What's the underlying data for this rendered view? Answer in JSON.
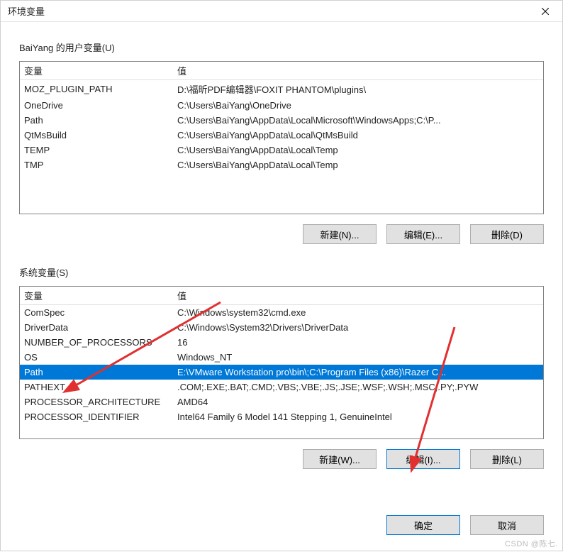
{
  "window": {
    "title": "环境变量",
    "close_icon": "close-icon"
  },
  "user_group": {
    "label": "BaiYang 的用户变量(U)",
    "col1": "变量",
    "col2": "值",
    "rows": [
      {
        "name": "MOZ_PLUGIN_PATH",
        "value": "D:\\福昕PDF编辑器\\FOXIT PHANTOM\\plugins\\"
      },
      {
        "name": "OneDrive",
        "value": "C:\\Users\\BaiYang\\OneDrive"
      },
      {
        "name": "Path",
        "value": "C:\\Users\\BaiYang\\AppData\\Local\\Microsoft\\WindowsApps;C:\\P..."
      },
      {
        "name": "QtMsBuild",
        "value": "C:\\Users\\BaiYang\\AppData\\Local\\QtMsBuild"
      },
      {
        "name": "TEMP",
        "value": "C:\\Users\\BaiYang\\AppData\\Local\\Temp"
      },
      {
        "name": "TMP",
        "value": "C:\\Users\\BaiYang\\AppData\\Local\\Temp"
      }
    ],
    "buttons": {
      "new": "新建(N)...",
      "edit": "编辑(E)...",
      "delete": "删除(D)"
    }
  },
  "system_group": {
    "label": "系统变量(S)",
    "col1": "变量",
    "col2": "值",
    "rows": [
      {
        "name": "ComSpec",
        "value": "C:\\Windows\\system32\\cmd.exe"
      },
      {
        "name": "DriverData",
        "value": "C:\\Windows\\System32\\Drivers\\DriverData"
      },
      {
        "name": "NUMBER_OF_PROCESSORS",
        "value": "16"
      },
      {
        "name": "OS",
        "value": "Windows_NT"
      },
      {
        "name": "Path",
        "value": "E:\\VMware Workstation pro\\bin\\;C:\\Program Files (x86)\\Razer C...",
        "selected": true
      },
      {
        "name": "PATHEXT",
        "value": ".COM;.EXE;.BAT;.CMD;.VBS;.VBE;.JS;.JSE;.WSF;.WSH;.MSC;.PY;.PYW"
      },
      {
        "name": "PROCESSOR_ARCHITECTURE",
        "value": "AMD64"
      },
      {
        "name": "PROCESSOR_IDENTIFIER",
        "value": "Intel64 Family 6 Model 141 Stepping 1, GenuineIntel"
      }
    ],
    "buttons": {
      "new": "新建(W)...",
      "edit": "编辑(I)...",
      "delete": "删除(L)"
    }
  },
  "dialog_buttons": {
    "ok": "确定",
    "cancel": "取消"
  },
  "watermark": "CSDN @陈七."
}
